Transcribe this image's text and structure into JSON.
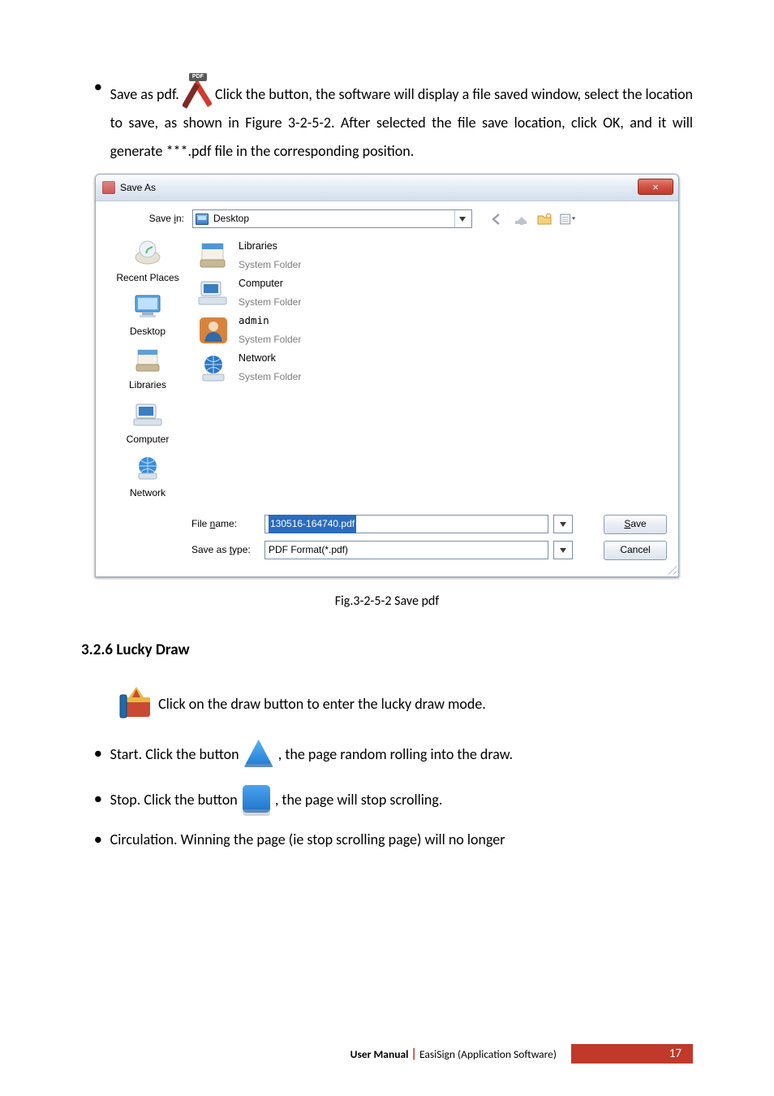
{
  "body": {
    "save_as_pdf": {
      "pre": "Save as pdf.",
      "post": "Click the button, the software will display a file saved window, select the location to save, as shown in Figure 3-2-5-2. After selected the file save location, click OK, and it will generate ***.pdf file in the corresponding position.",
      "pdf_tag": "PDF"
    },
    "lucky": {
      "heading": "3.2.6 Lucky Draw",
      "intro": "Click on the draw button to enter the lucky draw mode.",
      "start_pre": "Start. Click the button",
      "start_post": ", the page random rolling into the draw.",
      "stop_pre": "Stop. Click the button",
      "stop_post": ", the page will stop scrolling.",
      "circ": "Circulation. Winning the page (ie stop scrolling page) will no longer"
    },
    "caption": "Fig.3-2-5-2 Save pdf"
  },
  "dialog": {
    "title": "Save As",
    "close": "×",
    "savein_label": "Save in:",
    "savein_value": "Desktop",
    "toolbar": [
      "back",
      "up",
      "new-folder",
      "views"
    ],
    "places": [
      "Recent Places",
      "Desktop",
      "Libraries",
      "Computer",
      "Network"
    ],
    "items": [
      {
        "name": "Libraries",
        "sub": "System Folder"
      },
      {
        "name": "Computer",
        "sub": "System Folder"
      },
      {
        "name": "admin",
        "sub": "System Folder"
      },
      {
        "name": "Network",
        "sub": "System Folder"
      }
    ],
    "filename_label": "File name:",
    "filename_value": "130516-164740.pdf",
    "type_label": "Save as type:",
    "type_value": "PDF Format(*.pdf)",
    "save": "Save",
    "save_ul": "S",
    "save_rest": "ave",
    "cancel": "Cancel"
  },
  "footer": {
    "manual": "User Manual",
    "product": "EasiSign (Application Software)",
    "page": "17"
  }
}
